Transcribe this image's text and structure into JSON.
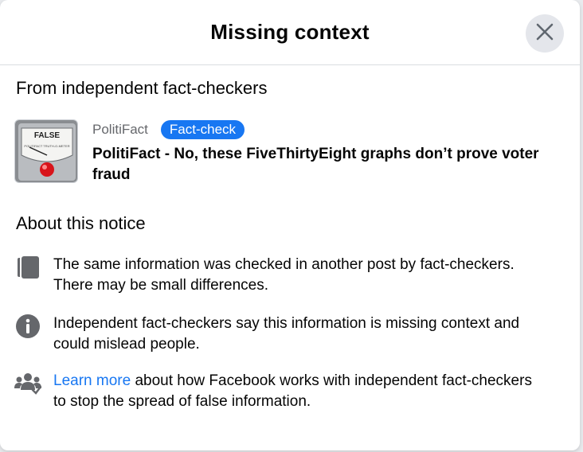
{
  "dialog": {
    "title": "Missing context"
  },
  "fact_checkers": {
    "heading": "From independent fact-checkers",
    "thumbnail": {
      "dial_label": "FALSE",
      "brand_text": "POLITIFACT TRUTH-O-METER"
    },
    "source": "PolitiFact",
    "badge": "Fact-check",
    "headline": "PolitiFact - No, these FiveThirtyEight graphs don’t prove voter fraud"
  },
  "about": {
    "heading": "About this notice",
    "items": [
      {
        "icon": "copy-icon",
        "text": "The same information was checked in another post by fact-checkers. There may be small differences."
      },
      {
        "icon": "info-icon",
        "text": "Independent fact-checkers say this information is missing context and could mislead people."
      },
      {
        "icon": "people-icon",
        "link_text": "Learn more",
        "text": " about how Facebook works with independent fact-checkers to stop the spread of false information."
      }
    ]
  },
  "colors": {
    "accent": "#1877f2",
    "secondary_text": "#65676b",
    "icon_gray": "#65676b"
  }
}
